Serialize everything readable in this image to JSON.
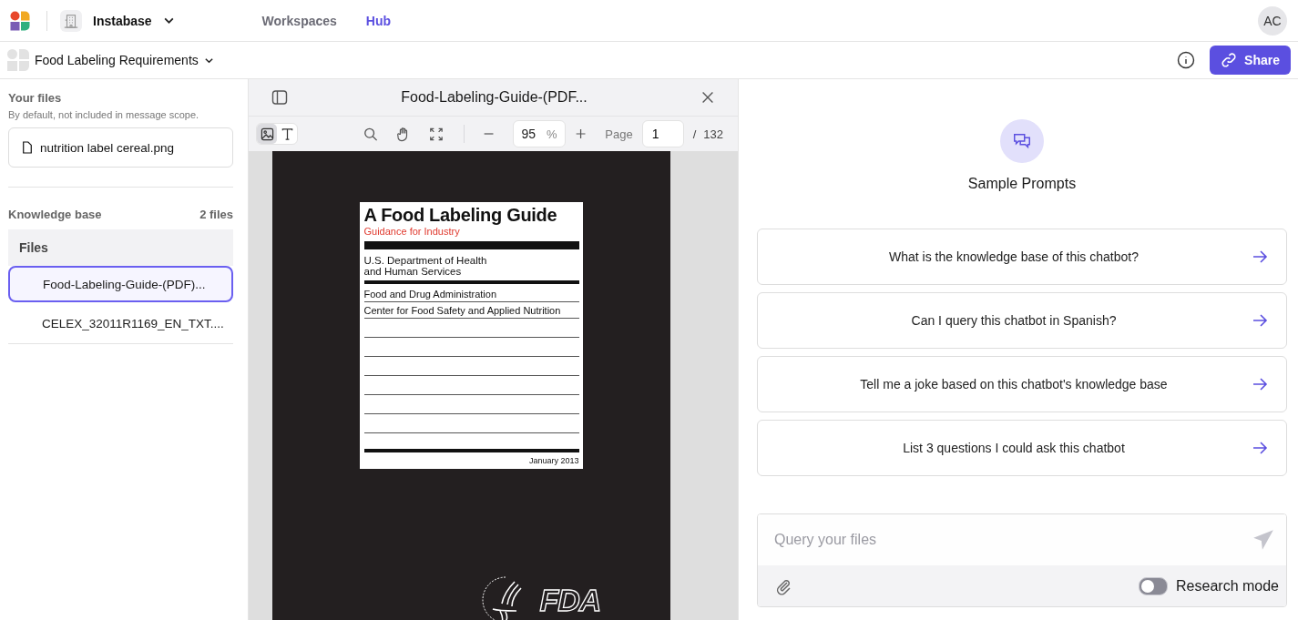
{
  "top_nav": {
    "org": "Instabase",
    "tabs": [
      {
        "label": "Workspaces",
        "selected": false
      },
      {
        "label": "Hub",
        "selected": true
      }
    ],
    "avatar": "AC"
  },
  "app_bar": {
    "title": "Food Labeling Requirements",
    "share": "Share"
  },
  "sidebar": {
    "your_files": {
      "heading": "Your files",
      "note": "By default, not included in message scope.",
      "files": [
        "nutrition label cereal.png"
      ]
    },
    "knowledge_base": {
      "heading": "Knowledge base",
      "count": "2 files",
      "group": "Files",
      "files": [
        {
          "name": "Food-Labeling-Guide-(PDF)...",
          "selected": true
        },
        {
          "name": "CELEX_32011R1169_EN_TXT....",
          "selected": false
        }
      ]
    }
  },
  "viewer": {
    "title": "Food-Labeling-Guide-(PDF...",
    "modes": [
      {
        "kind": "image",
        "selected": true
      },
      {
        "kind": "text",
        "selected": false
      }
    ],
    "zoom": "95",
    "zoom_unit": "%",
    "page_label": "Page",
    "page": "1",
    "page_separator": "/",
    "page_total": "132",
    "document": {
      "title": "A Food Labeling Guide",
      "subtitle": "Guidance for Industry",
      "department": "U.S. Department of Health and Human Services",
      "agency": "Food and Drug Administration",
      "center": "Center for Food Safety and Applied Nutrition",
      "date": "January 2013",
      "logo_text": "FDA"
    }
  },
  "chat": {
    "heading": "Sample Prompts",
    "prompts": [
      "What is the knowledge base of this chatbot?",
      "Can I query this chatbot in Spanish?",
      "Tell me a joke based on this chatbot's knowledge base",
      "List 3 questions I could ask this chatbot"
    ],
    "input": {
      "placeholder": "Query your files"
    },
    "research_mode": {
      "label": "Research mode",
      "on": false
    }
  }
}
